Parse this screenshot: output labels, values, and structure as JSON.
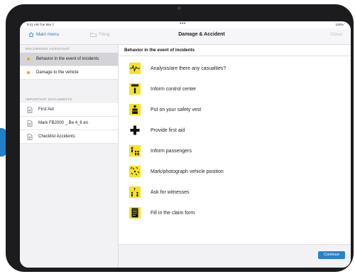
{
  "status_bar": {
    "left": "9:41 AM  Tue Mar 7",
    "dots": "•••",
    "right": "100%"
  },
  "nav": {
    "main_menu": "Main menu",
    "filing": "Filing",
    "title": "Damage & Accident",
    "close": "Close"
  },
  "sidebar": {
    "assistant_title": "Recording assistant",
    "assistant_items": [
      {
        "label": "Behavior in the event of incidents"
      },
      {
        "label": "Damage to the vehicle"
      }
    ],
    "documents_title": "Important documents",
    "documents": [
      {
        "label": "First Aid"
      },
      {
        "label": "Mark FB2000 _ Be 4_6 en"
      },
      {
        "label": "Checklist Accidents"
      }
    ]
  },
  "content": {
    "header": "Behavior in the event of incidents",
    "steps": [
      {
        "label": "Analysis/are there any casualties?",
        "icon": "pulse-icon"
      },
      {
        "label": "Inform control center",
        "icon": "info-icon"
      },
      {
        "label": "Put on your safety vest",
        "icon": "vest-icon"
      },
      {
        "label": "Provide first aid",
        "icon": "first-aid-cross-icon"
      },
      {
        "label": "Inform passengers",
        "icon": "passengers-icon"
      },
      {
        "label": "Mark/photograph vehicle position",
        "icon": "position-icon"
      },
      {
        "label": "Ask for witnesses",
        "icon": "witness-icon"
      },
      {
        "label": "Fill in the claim form",
        "icon": "form-icon"
      }
    ]
  },
  "footer": {
    "continue": "Continue"
  },
  "colors": {
    "accent": "#2a82c8",
    "bullet": "#f2a20b",
    "pictogram": "#f7e31f"
  }
}
